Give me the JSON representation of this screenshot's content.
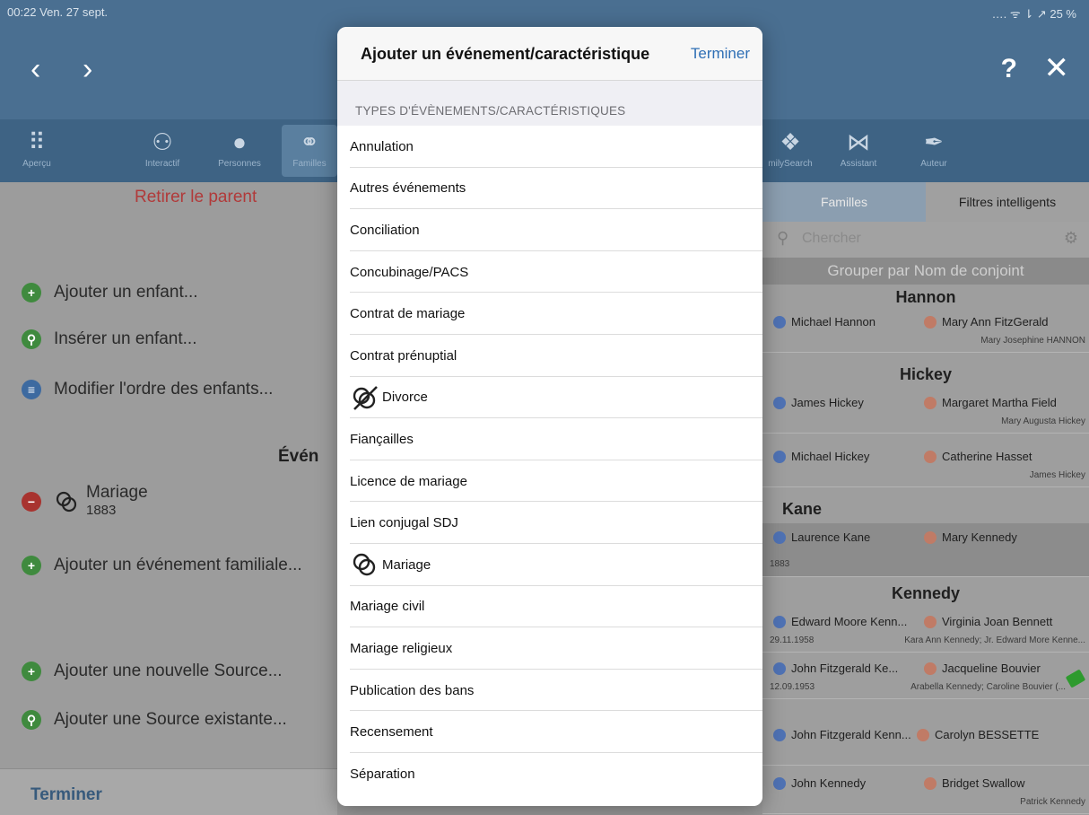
{
  "status": {
    "time_date": "00:22  Ven. 27 sept.",
    "right": "….  ᯤ  ⇂ ↗ 25 %"
  },
  "top": {
    "back": "‹",
    "forward": "›",
    "help": "?",
    "close": "✕"
  },
  "toolbar": {
    "items": [
      {
        "label": "Aperçu",
        "icon": "grid-icon"
      },
      {
        "label": "Interactif",
        "icon": "tree-icon"
      },
      {
        "label": "Personnes",
        "icon": "person-icon"
      },
      {
        "label": "Familles",
        "icon": "rings-icon"
      },
      {
        "label": "milySearch",
        "icon": "familysearch-icon"
      },
      {
        "label": "Assistant",
        "icon": "assistant-icon"
      },
      {
        "label": "Auteur",
        "icon": "pen-icon"
      }
    ]
  },
  "left": {
    "remove_parent": "Retirer le parent",
    "add_child": "Ajouter un enfant...",
    "insert_child": "Insérer un enfant...",
    "reorder_children": "Modifier l'ordre des enfants...",
    "events_header": "Évén",
    "mariage": "Mariage",
    "mariage_year": "1883",
    "add_family_event": "Ajouter un événement familiale...",
    "add_new_source": "Ajouter une nouvelle Source...",
    "add_existing_source": "Ajouter une Source existante...",
    "done": "Terminer"
  },
  "right": {
    "tabs": [
      "Familles",
      "Filtres intelligents"
    ],
    "search_placeholder": "Chercher",
    "group_by": "Grouper par Nom de conjoint",
    "groups": {
      "hannon": "Hannon",
      "hickey": "Hickey",
      "kane": "Kane",
      "kennedy": "Kennedy"
    },
    "families": [
      {
        "husband": "Michael Hannon",
        "wife": "Mary Ann FitzGerald",
        "children": "Mary Josephine HANNON",
        "date": ""
      },
      {
        "husband": "James Hickey",
        "wife": "Margaret Martha Field",
        "children": "Mary Augusta Hickey",
        "date": ""
      },
      {
        "husband": "Michael Hickey",
        "wife": "Catherine Hasset",
        "children": "James Hickey",
        "date": ""
      },
      {
        "husband": "Laurence Kane",
        "wife": "Mary Kennedy",
        "children": "",
        "date": "1883"
      },
      {
        "husband": "Edward Moore Kenn...",
        "wife": "Virginia Joan Bennett",
        "children": "Kara Ann Kennedy; Jr. Edward More Kenne...",
        "date": "29.11.1958"
      },
      {
        "husband": "John Fitzgerald Ke...",
        "wife": "Jacqueline Bouvier",
        "children": "Arabella Kennedy; Caroline Bouvier (...",
        "date": "12.09.1953"
      },
      {
        "husband": "John Fitzgerald Kenn...",
        "wife": "Carolyn BESSETTE",
        "children": "",
        "date": ""
      },
      {
        "husband": "John Kennedy",
        "wife": "Bridget Swallow",
        "children": "Patrick Kennedy",
        "date": ""
      }
    ]
  },
  "popover": {
    "title": "Ajouter un événement/caractéristique",
    "done": "Terminer",
    "section": "TYPES D'ÉVÈNEMENTS/CARACTÉRISTIQUES",
    "items": [
      "Annulation",
      "Autres événements",
      "Conciliation",
      "Concubinage/PACS",
      "Contrat de mariage",
      "Contrat prénuptial",
      "Divorce",
      "Fiançailles",
      "Licence de mariage",
      "Lien conjugal SDJ",
      "Mariage",
      "Mariage civil",
      "Mariage religieux",
      "Publication des bans",
      "Recensement",
      "Séparation"
    ]
  }
}
